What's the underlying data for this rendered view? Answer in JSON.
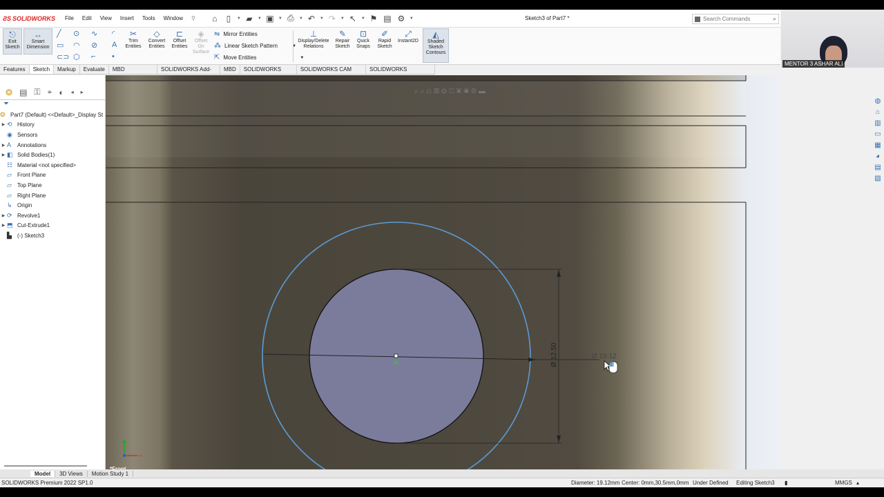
{
  "app": {
    "logo": "SOLIDWORKS",
    "document_title": "Sketch3 of Part7 *"
  },
  "menu": [
    "File",
    "Edit",
    "View",
    "Insert",
    "Tools",
    "Window"
  ],
  "search": {
    "placeholder": "Search Commands"
  },
  "webcam": {
    "label": "MENTOR 3 ASHAR ALI"
  },
  "commands": {
    "exit_sketch": "Exit Sketch",
    "smart_dimension": "Smart Dimension",
    "trim_entities": "Trim Entities",
    "convert_entities": "Convert Entities",
    "offset_entities": "Offset Entities",
    "offset_on_surface": "Offset On Surface",
    "mirror_entities": "Mirror Entities",
    "linear_sketch_pattern": "Linear Sketch Pattern",
    "move_entities": "Move Entities",
    "display_delete_relations": "Display/Delete Relations",
    "repair_sketch": "Repair Sketch",
    "quick_snaps": "Quick Snaps",
    "rapid_sketch": "Rapid Sketch",
    "instant2d": "Instant2D",
    "shaded_sketch_contours": "Shaded Sketch Contours"
  },
  "tabs": [
    "Features",
    "Sketch",
    "Markup",
    "Evaluate",
    "MBD Dimensions",
    "SOLIDWORKS Add-Ins",
    "MBD",
    "SOLIDWORKS CAM",
    "SOLIDWORKS CAM TBM",
    "SOLIDWORKS Inspection"
  ],
  "active_tab": "Sketch",
  "tree": {
    "root": "Part7 (Default) <<Default>_Display St",
    "items": [
      {
        "label": "History",
        "expand": true,
        "icon": "history-icon"
      },
      {
        "label": "Sensors",
        "expand": false,
        "icon": "sensor-icon"
      },
      {
        "label": "Annotations",
        "expand": true,
        "icon": "annotation-icon"
      },
      {
        "label": "Solid Bodies(1)",
        "expand": true,
        "icon": "solid-body-icon"
      },
      {
        "label": "Material <not specified>",
        "expand": false,
        "icon": "material-icon"
      },
      {
        "label": "Front Plane",
        "expand": false,
        "icon": "plane-icon"
      },
      {
        "label": "Top Plane",
        "expand": false,
        "icon": "plane-icon"
      },
      {
        "label": "Right Plane",
        "expand": false,
        "icon": "plane-icon"
      },
      {
        "label": "Origin",
        "expand": false,
        "icon": "origin-icon"
      },
      {
        "label": "Revolve1",
        "expand": true,
        "icon": "revolve-icon"
      },
      {
        "label": "Cut-Extrude1",
        "expand": true,
        "icon": "cut-extrude-icon"
      },
      {
        "label": "(-) Sketch3",
        "expand": false,
        "icon": "sketch-icon"
      }
    ]
  },
  "viewport": {
    "view_label": "*Front",
    "dimension_vertical": "Ø 12.50",
    "dimension_preview": "Ø 19.12"
  },
  "bottom_tabs": [
    "Model",
    "3D Views",
    "Motion Study 1"
  ],
  "status": {
    "product": "SOLIDWORKS Premium 2022 SP1.0",
    "diameter": "Diameter: 19.12mm",
    "center": "Center: 0mm,30.5mm,0mm",
    "state": "Under Defined",
    "editing": "Editing Sketch3",
    "units": "MMGS"
  },
  "colors": {
    "sketch_blue": "#5b9bd5",
    "brand_red": "#d22222",
    "hole_fill": "#7b7c9c"
  }
}
